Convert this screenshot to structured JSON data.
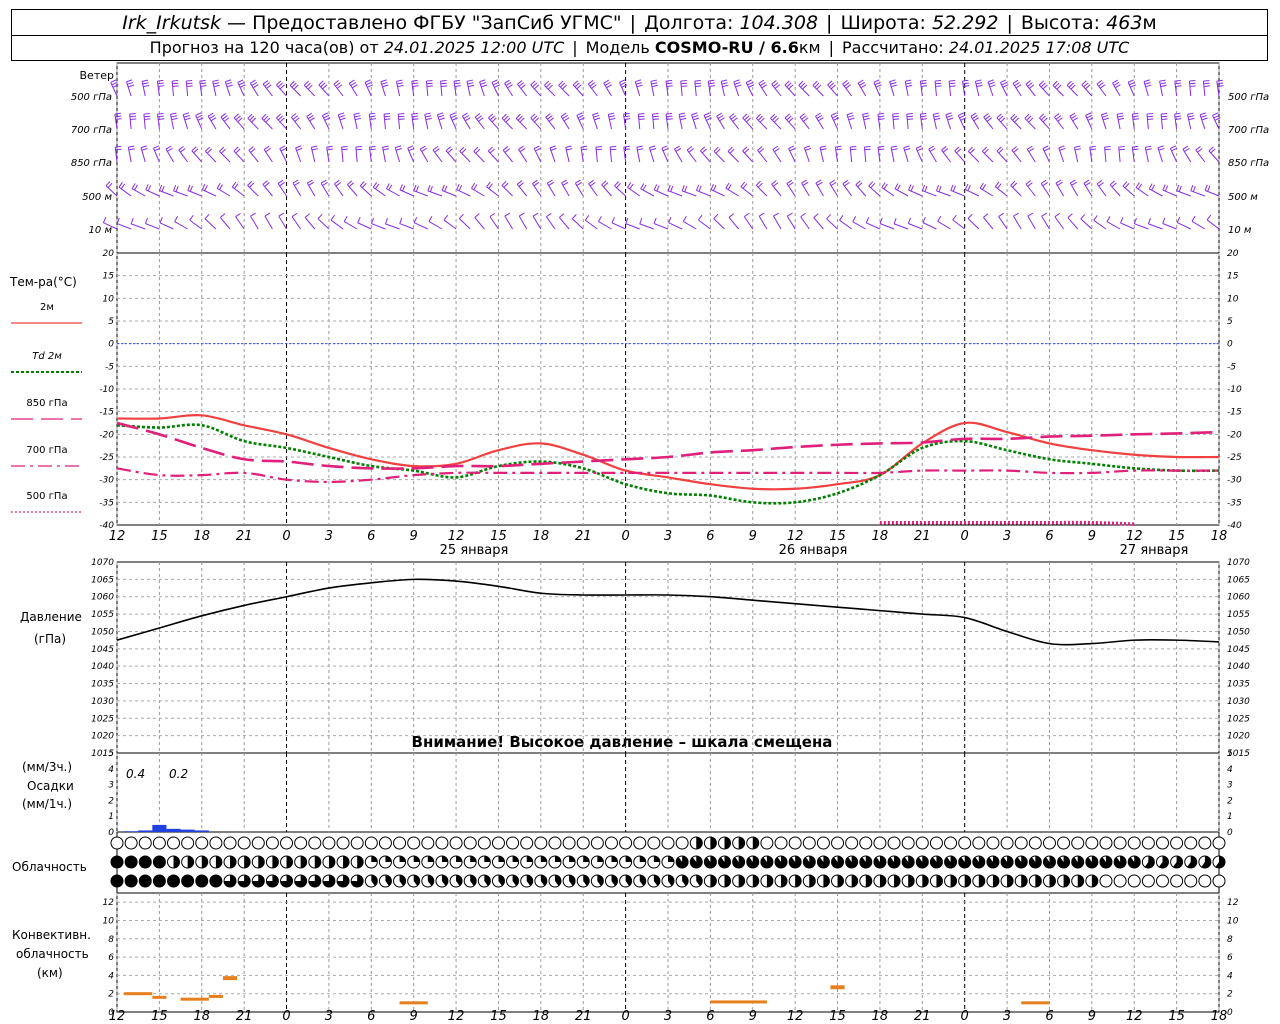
{
  "header": {
    "station": "Irk_Irkutsk",
    "provider": "— Предоставлено ФГБУ \"ЗапСиб УГМС\"",
    "lon_label": "Долгота:",
    "lon_value": "104.308",
    "lat_label": "Широта:",
    "lat_value": "52.292",
    "alt_label": "Высота:",
    "alt_value": "463",
    "alt_unit": "м",
    "forecast_label": "Прогноз на 120 часа(ов) от",
    "forecast_time": "24.01.2025 12:00 UTC",
    "model_label": "Модель",
    "model_name": "COSMO-RU / 6.6",
    "model_unit": "км",
    "calc_label": "Рассчитано:",
    "calc_time": "24.01.2025 17:08 UTC"
  },
  "wind_panel": {
    "title": "Ветер",
    "levels": [
      "500 гПа",
      "700 гПа",
      "850 гПа",
      "500 м",
      "10 м"
    ],
    "barb_color": "#8a2be2"
  },
  "temp_panel": {
    "title": "Тем-ра(°C)",
    "legend": [
      {
        "label": "2м",
        "color": "#f04040",
        "style": "solid"
      },
      {
        "label": "Td  2м",
        "color": "#008000",
        "style": "dotted"
      },
      {
        "label": "850 гПа",
        "color": "#e0207a",
        "style": "longdash"
      },
      {
        "label": "700 гПа",
        "color": "#e0207a",
        "style": "dashdot"
      },
      {
        "label": "500 гПа",
        "color": "#e0207a",
        "style": "dots"
      }
    ]
  },
  "pressure_panel": {
    "title": "Давление",
    "unit": "(гПа)",
    "warning": "Внимание! Высокое давление – шкала смещена"
  },
  "precip_panel": {
    "unit_3h": "(мм/3ч.)",
    "title": "Осадки",
    "unit_1h": "(мм/1ч.)",
    "annotations": [
      "0.4",
      "0.2"
    ]
  },
  "cloud_panel": {
    "title": "Облачность"
  },
  "conv_panel": {
    "title_1": "Конвективн.",
    "title_2": "облачность",
    "title_3": "(км)"
  },
  "axis": {
    "hour_labels": [
      "12",
      "15",
      "18",
      "21",
      "0",
      "3",
      "6",
      "9",
      "12",
      "15",
      "18",
      "21",
      "0",
      "3",
      "6",
      "9",
      "12",
      "15",
      "18",
      "21",
      "0",
      "3",
      "6",
      "9",
      "12",
      "15",
      "18"
    ],
    "days": [
      "25 января",
      "26 января",
      "27 января"
    ]
  },
  "chart_data": [
    {
      "type": "line",
      "title": "Тем-ра(°C)",
      "x_hours": [
        0,
        3,
        6,
        9,
        12,
        15,
        18,
        21,
        24,
        27,
        30,
        33,
        36,
        39,
        42,
        45,
        48,
        51,
        54,
        57,
        60,
        63,
        66,
        69,
        72,
        75,
        78
      ],
      "ylim": [
        -40,
        20
      ],
      "yticks": [
        -40,
        -35,
        -30,
        -25,
        -20,
        -15,
        -10,
        -5,
        0,
        5,
        10,
        15,
        20
      ],
      "series": [
        {
          "name": "2м",
          "values": [
            -16.5,
            -16.5,
            -15.8,
            -18,
            -20,
            -23,
            -25.5,
            -27,
            -26.5,
            -23.5,
            -22,
            -24.5,
            -28,
            -29.5,
            -31,
            -32,
            -32,
            -31,
            -29,
            -22,
            -17.5,
            -19.5,
            -22,
            -23.5,
            -24.5,
            -25,
            -25
          ]
        },
        {
          "name": "Td  2м",
          "values": [
            -18,
            -18.5,
            -18,
            -21.5,
            -23,
            -25,
            -27,
            -28,
            -29.5,
            -27,
            -26,
            -27.5,
            -31,
            -33,
            -33.5,
            -35,
            -35,
            -33,
            -29,
            -23,
            -21.5,
            -23.5,
            -25.5,
            -26.5,
            -27.5,
            -28,
            -28
          ]
        },
        {
          "name": "850 гПа",
          "values": [
            -17.5,
            -20,
            -23,
            -25.5,
            -26,
            -27,
            -27.5,
            -27.5,
            -27,
            -27,
            -26.5,
            -26,
            -25.5,
            -25,
            -24,
            -23.5,
            -22.8,
            -22.3,
            -22,
            -21.8,
            -21,
            -21,
            -20.5,
            -20.3,
            -20,
            -19.8,
            -19.5
          ]
        },
        {
          "name": "700 гПа",
          "values": [
            -27.5,
            -29,
            -29,
            -28.5,
            -30,
            -30.5,
            -30,
            -29,
            -28.5,
            -28.5,
            -28.5,
            -28.5,
            -28.5,
            -28.5,
            -28.5,
            -28.5,
            -28.5,
            -28.5,
            -28.5,
            -28,
            -28,
            -28,
            -28.5,
            -28.5,
            -28,
            -28,
            -28
          ]
        },
        {
          "name": "500 гПа",
          "values": [
            null,
            null,
            null,
            null,
            null,
            null,
            null,
            null,
            null,
            null,
            null,
            null,
            null,
            null,
            null,
            null,
            null,
            null,
            -39.5,
            -39.5,
            -39.5,
            -39.5,
            -39.5,
            -39.5,
            -39.8,
            null,
            null
          ]
        }
      ]
    },
    {
      "type": "line",
      "title": "Давление",
      "x_hours": [
        0,
        3,
        6,
        9,
        12,
        15,
        18,
        21,
        24,
        27,
        30,
        33,
        36,
        39,
        42,
        45,
        48,
        51,
        54,
        57,
        60,
        63,
        66,
        69,
        72,
        75,
        78
      ],
      "ylim": [
        1015,
        1070
      ],
      "yticks": [
        1015,
        1020,
        1025,
        1030,
        1035,
        1040,
        1045,
        1050,
        1055,
        1060,
        1065,
        1070
      ],
      "series": [
        {
          "name": "",
          "values": [
            1047.5,
            1051,
            1054.5,
            1057.5,
            1060,
            1062.5,
            1064,
            1065,
            1064.5,
            1063,
            1061,
            1060.5,
            1060.5,
            1060.5,
            1060,
            1059,
            1058,
            1057,
            1056,
            1055,
            1054,
            1050,
            1046.5,
            1046.5,
            1047.5,
            1047.5,
            1047
          ]
        }
      ]
    },
    {
      "type": "bar",
      "title": "Осадки",
      "x_hours": [
        1,
        2,
        3,
        4,
        5,
        6
      ],
      "ylim": [
        0,
        5
      ],
      "yticks": [
        0,
        1,
        2,
        3,
        4,
        5
      ],
      "series": [
        {
          "name": "",
          "values": [
            0.05,
            0.1,
            0.45,
            0.2,
            0.15,
            0.1
          ]
        }
      ]
    },
    {
      "type": "bar",
      "title": "Конвективн. облачность (км)",
      "ylim": [
        0,
        13
      ],
      "yticks": [
        0,
        2,
        4,
        6,
        8,
        10,
        12
      ],
      "series": [
        {
          "name": "",
          "segments": [
            {
              "x0": 0.5,
              "x1": 2.5,
              "y": 2.0
            },
            {
              "x0": 2.5,
              "x1": 3.5,
              "y": 1.6
            },
            {
              "x0": 4.5,
              "x1": 6.5,
              "y": 1.4
            },
            {
              "x0": 6.5,
              "x1": 7.5,
              "y": 1.7
            },
            {
              "x0": 7.5,
              "x1": 8.5,
              "y": 3.7
            },
            {
              "x0": 20,
              "x1": 22,
              "y": 1.0
            },
            {
              "x0": 42,
              "x1": 46,
              "y": 1.1
            },
            {
              "x0": 50.5,
              "x1": 51.5,
              "y": 2.7
            },
            {
              "x0": 64,
              "x1": 66,
              "y": 1.0
            }
          ]
        }
      ]
    }
  ]
}
